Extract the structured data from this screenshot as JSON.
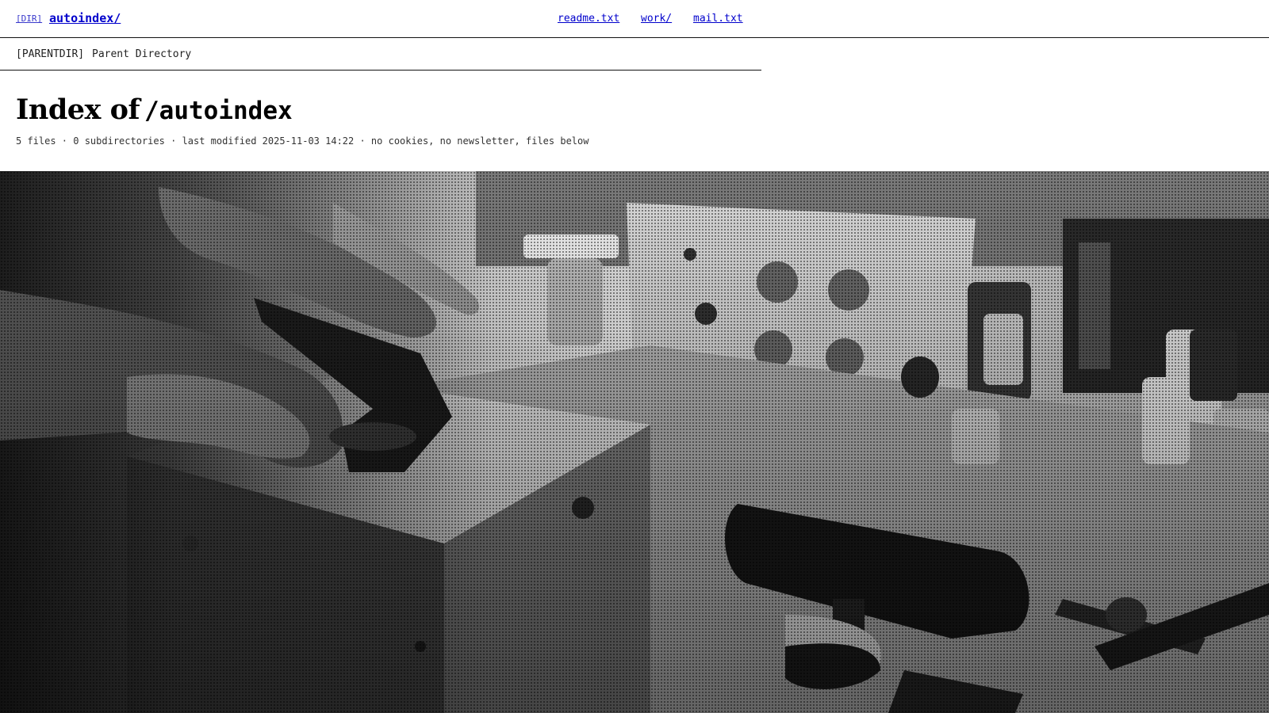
{
  "header": {
    "dir_tag": "[DIR]",
    "site_name": "autoindex/",
    "nav": [
      {
        "label": "readme.txt"
      },
      {
        "label": "work/"
      },
      {
        "label": "mail.txt"
      }
    ]
  },
  "parent": {
    "tag": "[PARENTDIR]",
    "label": "Parent Directory"
  },
  "index": {
    "lead": "Index of",
    "path": "/autoindex",
    "summary": "5 files · 0 subdirectories · last modified 2025-11-03 14:22 · no cookies, no newsletter, files below"
  },
  "hero": {
    "style": "halftone-black-white",
    "subject": "workbench-with-hands-and-tools"
  }
}
